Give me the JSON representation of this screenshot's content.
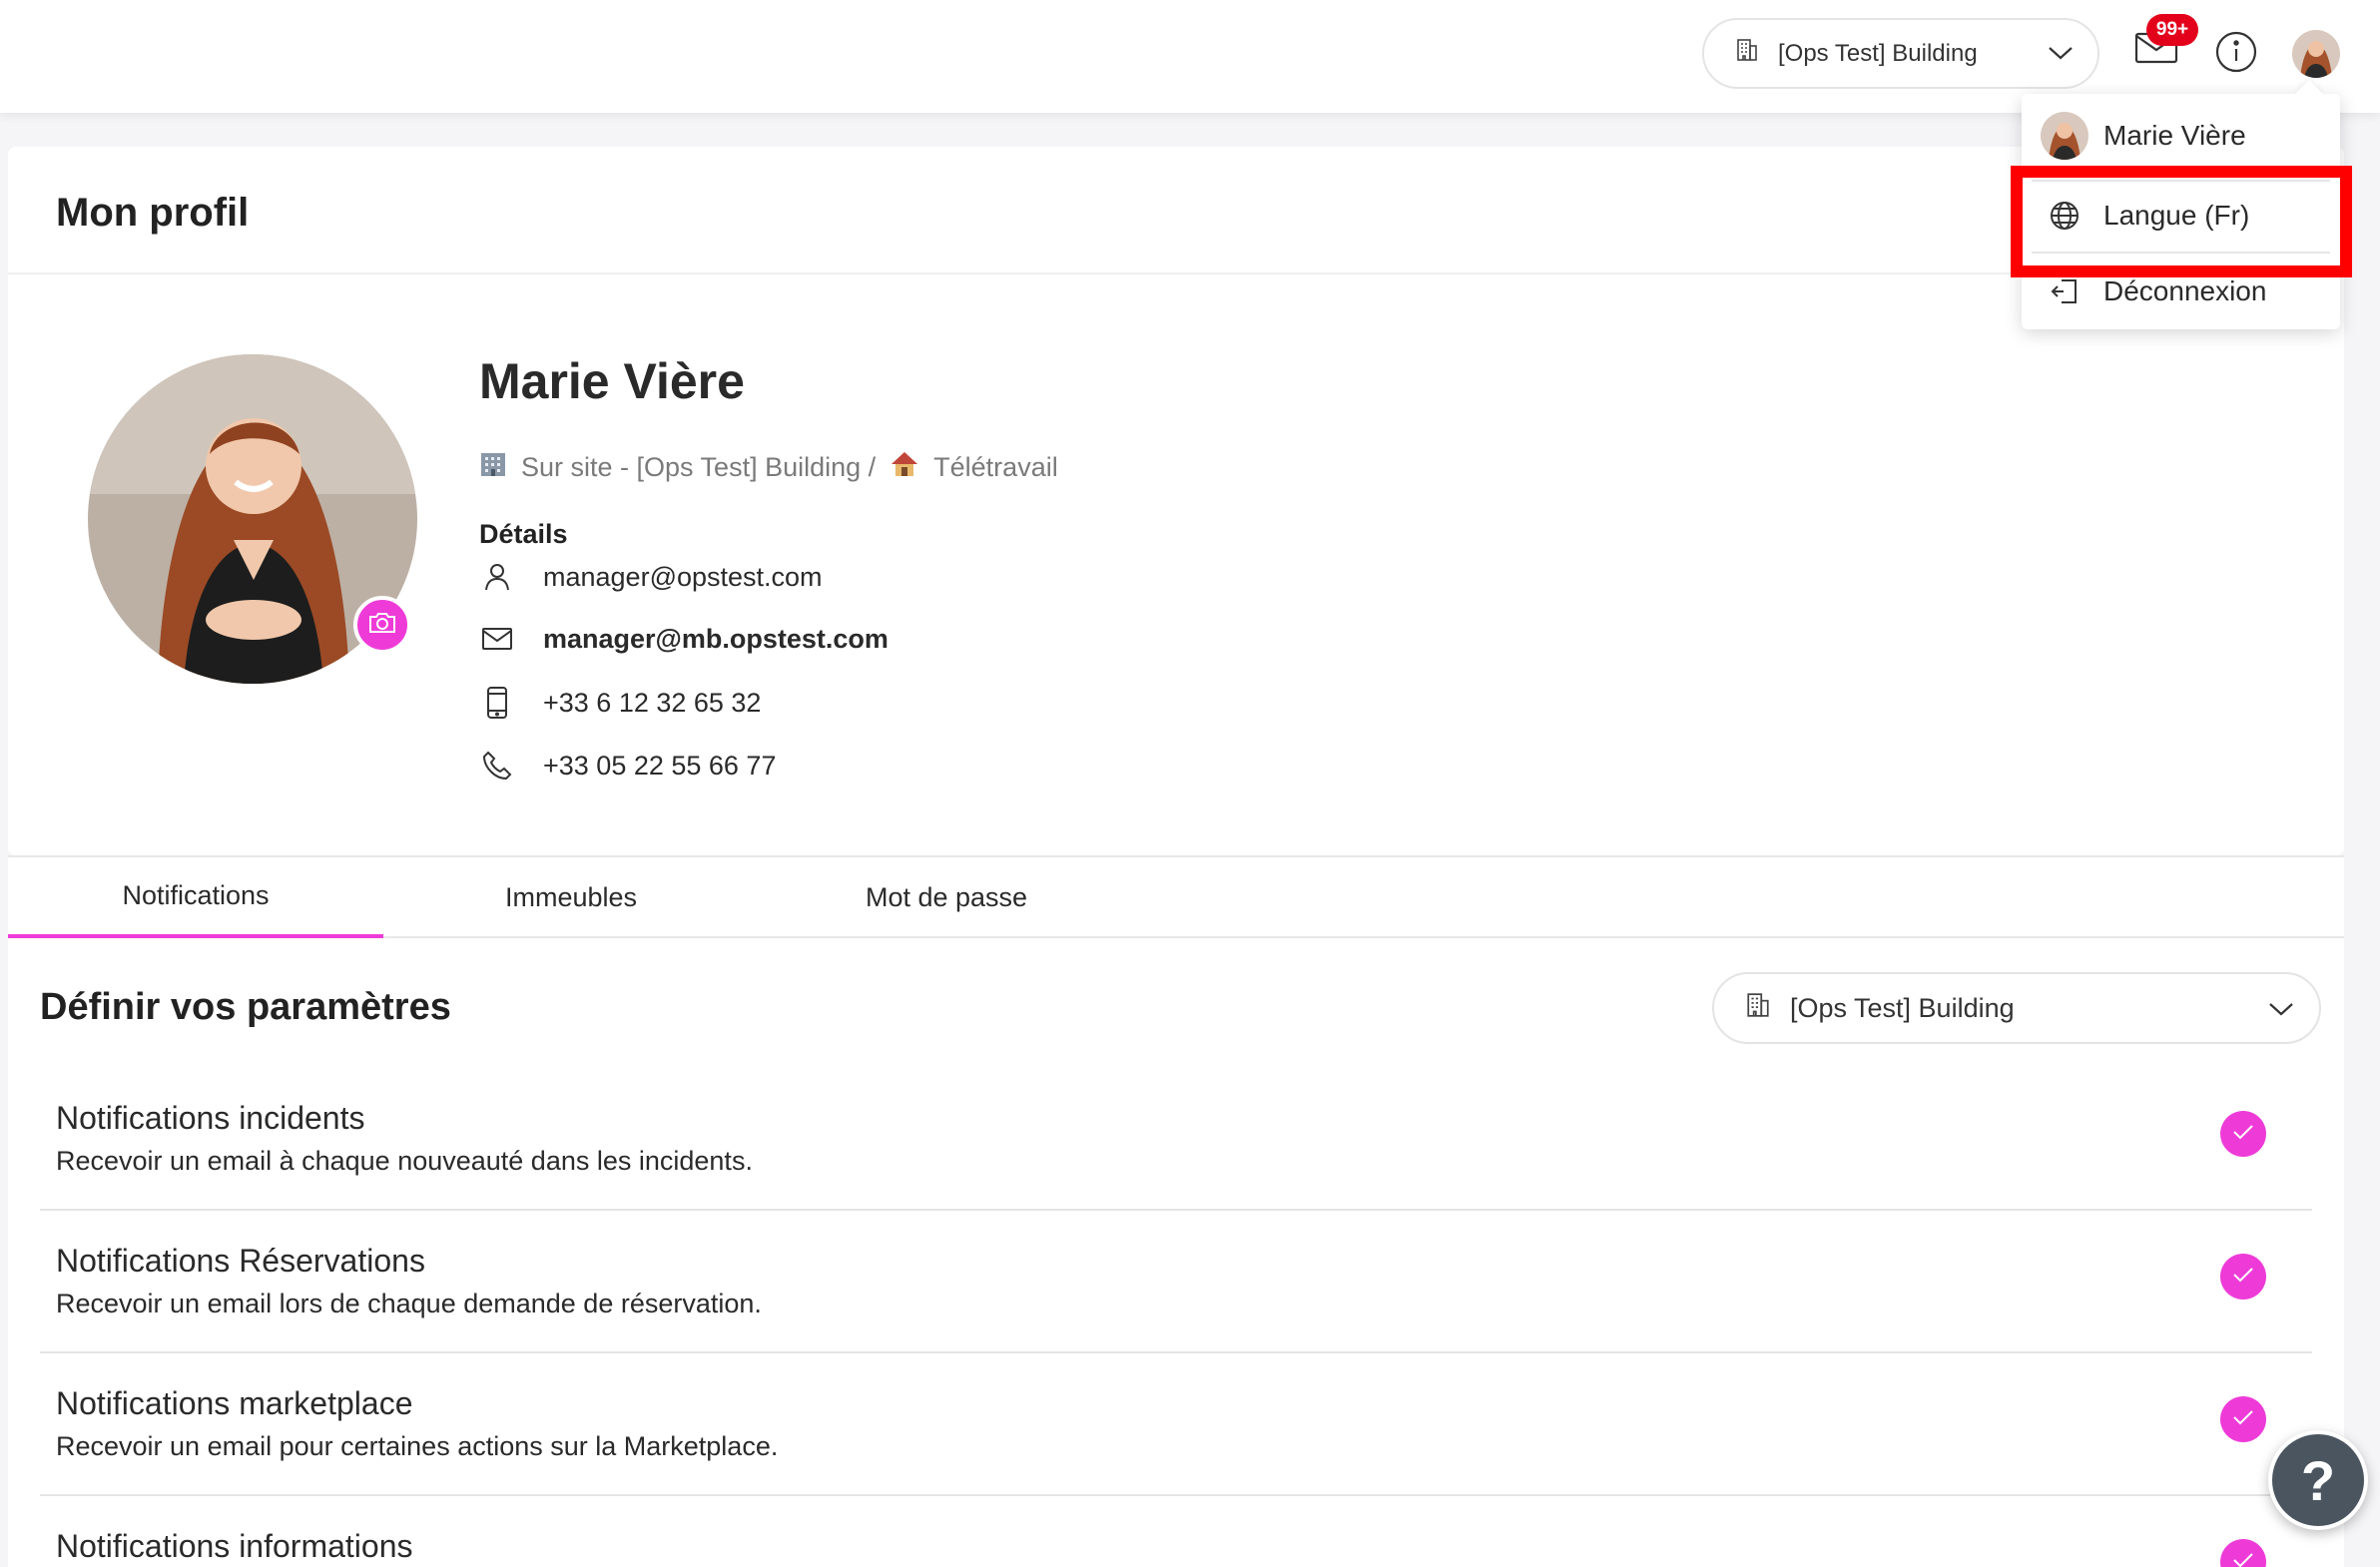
{
  "header": {
    "building_select": "[Ops Test] Building",
    "notifications_badge": "99+"
  },
  "user_menu": {
    "name": "Marie Vière",
    "language": "Langue (Fr)",
    "logout": "Déconnexion"
  },
  "profile": {
    "page_title": "Mon profil",
    "name": "Marie Vière",
    "location_prefix": "Sur site - [Ops Test] Building /",
    "location_remote": "Télétravail",
    "details_title": "Détails",
    "username": "manager@opstest.com",
    "email": "manager@mb.opstest.com",
    "mobile": "+33 6 12 32 65 32",
    "phone": "+33 05 22 55 66 77"
  },
  "tabs": [
    {
      "label": "Notifications",
      "active": true
    },
    {
      "label": "Immeubles",
      "active": false
    },
    {
      "label": "Mot de passe",
      "active": false
    }
  ],
  "settings": {
    "title": "Définir vos paramètres",
    "building_select": "[Ops Test] Building",
    "items": [
      {
        "title": "Notifications incidents",
        "desc": "Recevoir un email à chaque nouveauté dans les incidents.",
        "checked": true
      },
      {
        "title": "Notifications Réservations",
        "desc": "Recevoir un email lors de chaque demande de réservation.",
        "checked": true
      },
      {
        "title": "Notifications marketplace",
        "desc": "Recevoir un email pour certaines actions sur la Marketplace.",
        "checked": true
      },
      {
        "title": "Notifications informations",
        "desc": "",
        "checked": true
      }
    ]
  },
  "help_button": "?",
  "colors": {
    "accent": "#ee3bd8",
    "highlight": "#ff0000",
    "badge": "#e3001b",
    "help_bg": "#4a5560"
  }
}
